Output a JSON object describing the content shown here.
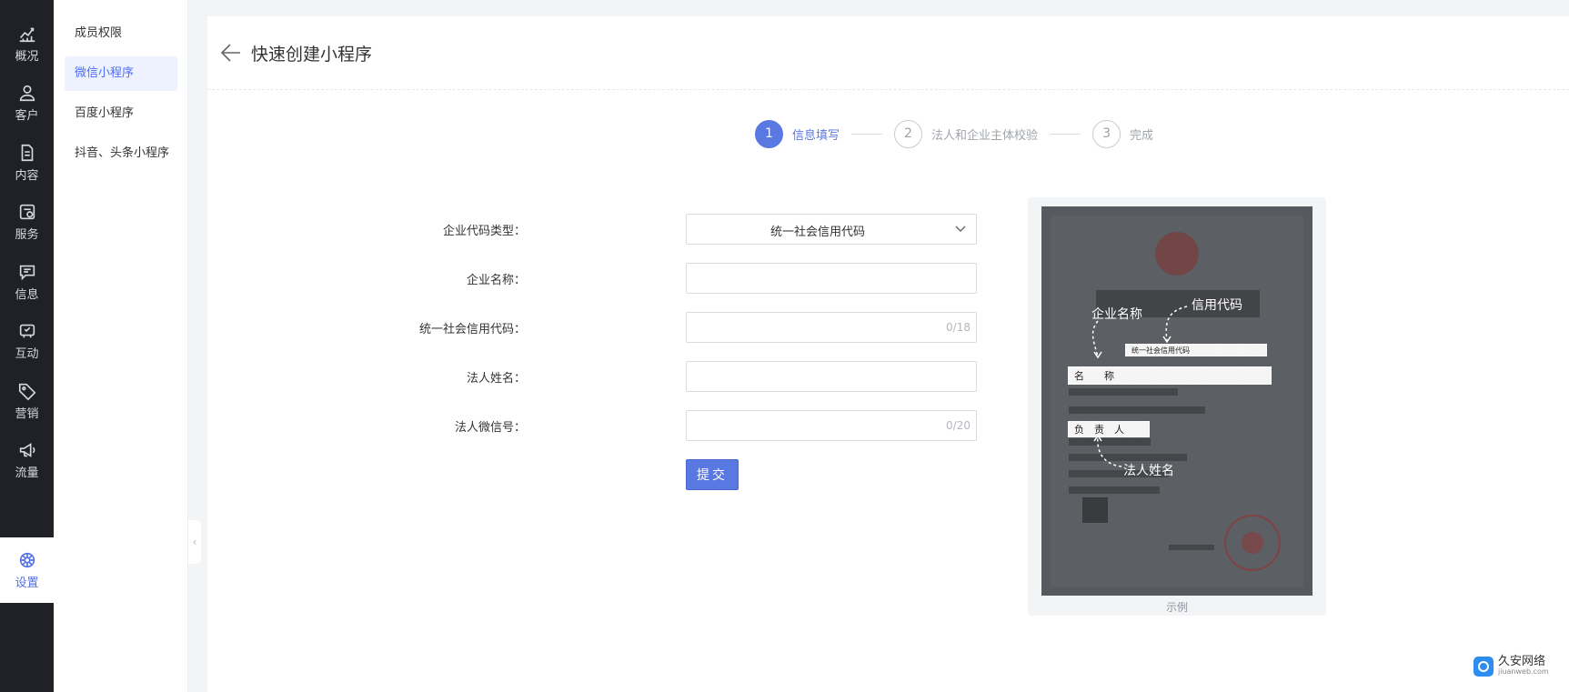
{
  "rail": {
    "items": [
      {
        "label": "概况",
        "icon": "chart-icon"
      },
      {
        "label": "客户",
        "icon": "user-icon"
      },
      {
        "label": "内容",
        "icon": "document-icon"
      },
      {
        "label": "服务",
        "icon": "service-icon"
      },
      {
        "label": "信息",
        "icon": "message-icon"
      },
      {
        "label": "互动",
        "icon": "interaction-icon"
      },
      {
        "label": "营销",
        "icon": "tag-icon"
      },
      {
        "label": "流量",
        "icon": "megaphone-icon"
      },
      {
        "label": "设置",
        "icon": "gear-icon",
        "active": true
      }
    ],
    "active_color": "#5470e6"
  },
  "submenu": {
    "items": [
      {
        "label": "成员权限"
      },
      {
        "label": "微信小程序",
        "active": true
      },
      {
        "label": "百度小程序"
      },
      {
        "label": "抖音、头条小程序"
      }
    ]
  },
  "header": {
    "title": "快速创建小程序"
  },
  "steps": [
    {
      "number": "1",
      "label": "信息填写",
      "active": true
    },
    {
      "number": "2",
      "label": "法人和企业主体校验"
    },
    {
      "number": "3",
      "label": "完成"
    }
  ],
  "form": {
    "code_type": {
      "label": "企业代码类型：",
      "value": "统一社会信用代码"
    },
    "company_name": {
      "label": "企业名称：",
      "value": ""
    },
    "credit_code": {
      "label": "统一社会信用代码：",
      "value": "",
      "counter": "0/18"
    },
    "legal_name": {
      "label": "法人姓名：",
      "value": ""
    },
    "legal_wechat": {
      "label": "法人微信号：",
      "value": "",
      "counter": "0/20"
    },
    "submit_label": "提交"
  },
  "example": {
    "caption": "示例",
    "annotations": {
      "company_name": "企业名称",
      "credit_code": "信用代码",
      "legal_name": "法人姓名"
    },
    "boxes": {
      "credit_code": "统一社会信用代码",
      "name": "名　　称",
      "legal": "负　责　人"
    }
  },
  "watermark": {
    "name": "久安网络",
    "domain": "jiuanweb.com"
  },
  "colors": {
    "primary": "#5a78e2",
    "rail_bg": "#1f2127"
  }
}
